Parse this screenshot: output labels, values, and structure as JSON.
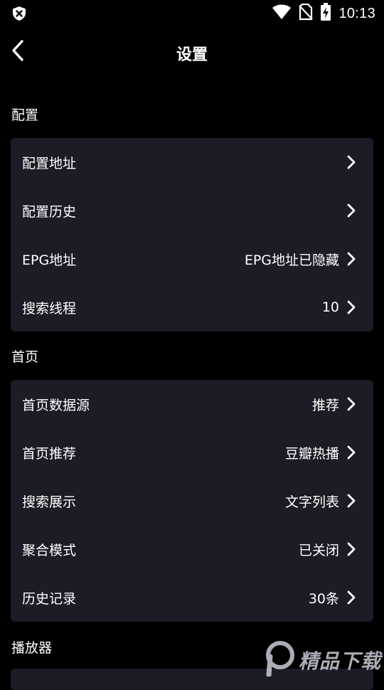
{
  "status_bar": {
    "time": "10:13",
    "icons": [
      "shield-x-icon",
      "wifi-icon",
      "no-sim-icon",
      "battery-charging-icon"
    ]
  },
  "header": {
    "title": "设置",
    "back_icon": "chevron-left-icon"
  },
  "sections": [
    {
      "title": "配置",
      "rows": [
        {
          "label": "配置地址",
          "value": ""
        },
        {
          "label": "配置历史",
          "value": ""
        },
        {
          "label": "EPG地址",
          "value": "EPG地址已隐藏"
        },
        {
          "label": "搜索线程",
          "value": "10"
        }
      ]
    },
    {
      "title": "首页",
      "rows": [
        {
          "label": "首页数据源",
          "value": "推荐"
        },
        {
          "label": "首页推荐",
          "value": "豆瓣热播"
        },
        {
          "label": "搜索展示",
          "value": "文字列表"
        },
        {
          "label": "聚合模式",
          "value": "已关闭"
        },
        {
          "label": "历史记录",
          "value": "30条"
        }
      ]
    },
    {
      "title": "播放器",
      "rows": []
    }
  ],
  "watermark": {
    "text": "精品下载"
  },
  "colors": {
    "background": "#000000",
    "card": "#1b1c26",
    "text": "#ffffff"
  }
}
